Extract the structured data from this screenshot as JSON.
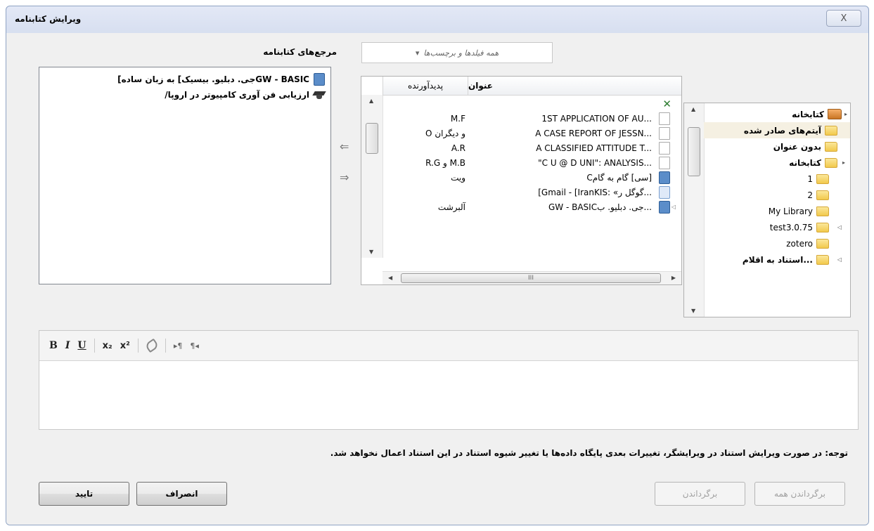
{
  "window": {
    "title": "ویرایش کتابنامه",
    "close_label": "X"
  },
  "bibliography": {
    "label": "مرجع‌های کتابنامه",
    "items": [
      {
        "icon": "book-icon",
        "text": "GW - BASICجی. دبلیو. بیسیک] به زبان ساده]"
      },
      {
        "icon": "thesis-icon",
        "text": "ارزیابی فن آوری کامپیوتر در اروپا/"
      }
    ]
  },
  "filter": {
    "placeholder": "همه فیلدها و برچسب‌ها",
    "caret": "▾"
  },
  "items_list": {
    "columns": {
      "title": "عنوان",
      "creator": "پدیدآورنده"
    },
    "rows": [
      {
        "icon": "doc",
        "title": "1ST APPLICATION OF AU...",
        "creator": "M.F"
      },
      {
        "icon": "doc",
        "title": "A CASE REPORT OF JESSN...",
        "creator": "O و دیگران"
      },
      {
        "icon": "doc",
        "title": "A CLASSIFIED ATTITUDE T...",
        "creator": "A.R"
      },
      {
        "icon": "doc",
        "title": "\"C U @ D UNI\": ANALYSIS...",
        "creator": "R.G و M.B"
      },
      {
        "icon": "book",
        "title": "Cسی] گام به گام]",
        "creator": "ویت"
      },
      {
        "icon": "web",
        "title": "[Gmail - [IranKIS: «گوگل ر...",
        "creator": ""
      },
      {
        "icon": "book",
        "title": "GW - BASICجی. دبلیو. ب...",
        "creator": "آلبرشت"
      }
    ],
    "hscroll_marker": "III"
  },
  "collections": {
    "items": [
      {
        "label": "کتابخانه",
        "icon": "library",
        "expander": "▸",
        "bold": true,
        "selected": false
      },
      {
        "label": "آیتم‌های صادر شده",
        "icon": "folder",
        "expander": "",
        "bold": true,
        "selected": true
      },
      {
        "label": "بدون عنوان",
        "icon": "folder",
        "expander": "",
        "bold": true,
        "selected": false
      },
      {
        "label": "کتابخانه",
        "icon": "folder",
        "expander": "▸",
        "bold": true,
        "selected": false
      },
      {
        "label": "1",
        "icon": "folder",
        "expander": "",
        "bold": false,
        "selected": false
      },
      {
        "label": "2",
        "icon": "folder",
        "expander": "",
        "bold": false,
        "selected": false
      },
      {
        "label": "My Library",
        "icon": "folder",
        "expander": "",
        "bold": false,
        "selected": false
      },
      {
        "label": "test3.0.75",
        "icon": "folder",
        "expander": "◁",
        "bold": false,
        "selected": false
      },
      {
        "label": "zotero",
        "icon": "folder",
        "expander": "",
        "bold": false,
        "selected": false
      },
      {
        "label": "استناد به اقلام...",
        "icon": "folder",
        "expander": "◁",
        "bold": true,
        "selected": false
      }
    ]
  },
  "editor_toolbar": {
    "bold": "B",
    "italic": "I",
    "underline": "U",
    "subscript": "x₂",
    "superscript": "x²",
    "ltr": "▸¶",
    "rtl": "¶◂"
  },
  "note": "توجه: در صورت ویرایش استناد در ویرایشگر، تغییرات بعدی پایگاه داده‌ها یا تغییر شیوه استناد در این استناد اعمال نخواهد شد.",
  "buttons": {
    "revert_all": "برگرداندن همه",
    "revert": "برگرداندن",
    "cancel": "انصراف",
    "ok": "تایید"
  }
}
